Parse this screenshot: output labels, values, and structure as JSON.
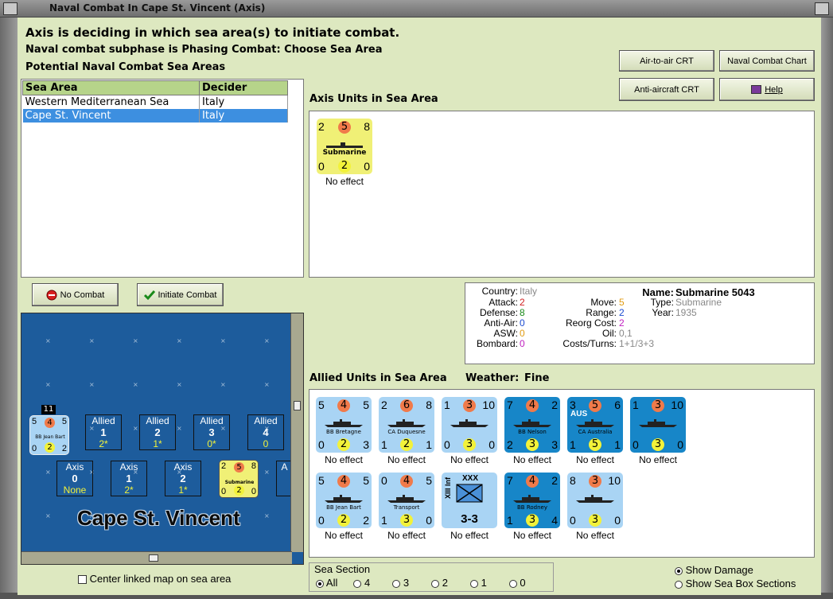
{
  "window": {
    "title": "Naval Combat In Cape St. Vincent (Axis)"
  },
  "headers": {
    "status": "Axis is deciding in which sea area(s) to initiate combat.",
    "subphase": "Naval combat subphase is Phasing Combat: Choose Sea Area",
    "potential": "Potential Naval Combat Sea Areas"
  },
  "buttons": {
    "air_to_air": "Air-to-air CRT",
    "naval_chart": "Naval Combat Chart",
    "anti_aircraft": "Anti-aircraft CRT",
    "help": "Help",
    "no_combat": "No Combat",
    "initiate": "Initiate Combat"
  },
  "sea_table": {
    "headers": [
      "Sea Area",
      "Decider"
    ],
    "rows": [
      {
        "area": "Western Mediterranean Sea",
        "decider": "Italy"
      },
      {
        "area": "Cape St. Vincent",
        "decider": "Italy"
      }
    ]
  },
  "axis_section": {
    "label": "Axis Units in Sea Area",
    "unit": {
      "tl": "2",
      "tc": "5",
      "tr": "8",
      "name": "Submarine",
      "bl": "0",
      "bc": "2",
      "br": "0",
      "effect": "No effect"
    }
  },
  "info": {
    "country_k": "Country:",
    "country_v": "Italy",
    "attack_k": "Attack:",
    "attack_v": "2",
    "defense_k": "Defense:",
    "defense_v": "8",
    "antiair_k": "Anti-Air:",
    "antiair_v": "0",
    "asw_k": "ASW:",
    "asw_v": "0",
    "bombard_k": "Bombard:",
    "bombard_v": "0",
    "name_k": "Name:",
    "name_v": "Submarine 5043",
    "type_k": "Type:",
    "type_v": "Submarine",
    "year_k": "Year:",
    "year_v": "1935",
    "move_k": "Move:",
    "move_v": "5",
    "range_k": "Range:",
    "range_v": "2",
    "reorg_k": "Reorg Cost:",
    "reorg_v": "2",
    "oil_k": "Oil:",
    "oil_v": "0,1",
    "costs_k": "Costs/Turns:",
    "costs_v": "1+1/3+3"
  },
  "allied_section": {
    "label": "Allied Units in Sea Area",
    "weather_label": "Weather:",
    "weather": "Fine",
    "units": [
      {
        "tl": "5",
        "tc": "4",
        "tr": "5",
        "name": "BB Bretagne",
        "bl": "0",
        "bc": "2",
        "br": "3",
        "effect": "No effect",
        "style": "lb"
      },
      {
        "tl": "2",
        "tc": "6",
        "tr": "8",
        "name": "CA Duquesne",
        "bl": "1",
        "bc": "2",
        "br": "1",
        "effect": "No effect",
        "style": "lb"
      },
      {
        "tl": "1",
        "tc": "3",
        "tr": "10",
        "name": "",
        "bl": "0",
        "bc": "3",
        "br": "0",
        "effect": "No effect",
        "style": "lb"
      },
      {
        "tl": "7",
        "tc": "4",
        "tr": "2",
        "name": "BB Nelson",
        "bl": "2",
        "bc": "3",
        "br": "3",
        "effect": "No effect",
        "style": "db"
      },
      {
        "tl": "3",
        "tc": "5",
        "tr": "6",
        "name": "CA Australia",
        "bl": "1",
        "bc": "5",
        "br": "1",
        "effect": "No effect",
        "style": "db"
      },
      {
        "tl": "1",
        "tc": "3",
        "tr": "10",
        "name": "",
        "bl": "0",
        "bc": "3",
        "br": "0",
        "effect": "No effect",
        "style": "db"
      },
      {
        "tl": "5",
        "tc": "4",
        "tr": "5",
        "name": "BB Jean Bart",
        "bl": "0",
        "bc": "2",
        "br": "2",
        "effect": "No effect",
        "style": "lb"
      },
      {
        "tl": "0",
        "tc": "4",
        "tr": "5",
        "name": "Transport",
        "bl": "1",
        "bc": "3",
        "br": "0",
        "effect": "No effect",
        "style": "lb"
      },
      {
        "tl": "",
        "tc": "",
        "tr": "",
        "name": "3-3",
        "bl": "",
        "bc": "",
        "br": "",
        "effect": "No effect",
        "style": "lb",
        "land": true
      },
      {
        "tl": "7",
        "tc": "4",
        "tr": "2",
        "name": "BB Rodney",
        "bl": "1",
        "bc": "3",
        "br": "4",
        "effect": "No effect",
        "style": "db"
      },
      {
        "tl": "8",
        "tc": "3",
        "tr": "10",
        "name": "",
        "bl": "0",
        "bc": "3",
        "br": "0",
        "effect": "No effect",
        "style": "lb"
      }
    ],
    "aus_tag": "AUS",
    "land_top": "XXX",
    "land_side": "XIII Inf"
  },
  "map": {
    "name": "Cape St. Vincent",
    "stack_count": "11",
    "mini_counter": {
      "tl": "5",
      "tc": "4",
      "tr": "5",
      "name": "BB Jean Bart",
      "bl": "0",
      "bc": "2",
      "br": "2"
    },
    "allied_boxes": [
      {
        "side": "Allied",
        "n": "1",
        "v": "2*"
      },
      {
        "side": "Allied",
        "n": "2",
        "v": "1*"
      },
      {
        "side": "Allied",
        "n": "3",
        "v": "0*"
      },
      {
        "side": "Allied",
        "n": "4",
        "v": "0"
      }
    ],
    "axis_boxes": [
      {
        "side": "Axis",
        "n": "0",
        "v": "None"
      },
      {
        "side": "Axis",
        "n": "1",
        "v": "2*"
      },
      {
        "side": "Axis",
        "n": "2",
        "v": "1*"
      }
    ],
    "axis_partial": "A",
    "sub_counter": {
      "tl": "2",
      "tc": "5",
      "tr": "8",
      "name": "Submarine",
      "bl": "0",
      "bc": "2",
      "br": "0"
    }
  },
  "center_map_label": "Center linked map on sea area",
  "sea_section": {
    "label": "Sea Section",
    "options": [
      "All",
      "4",
      "3",
      "2",
      "1",
      "0"
    ],
    "selected": "All"
  },
  "show_damage": "Show Damage",
  "show_sea_box": "Show Sea Box Sections"
}
